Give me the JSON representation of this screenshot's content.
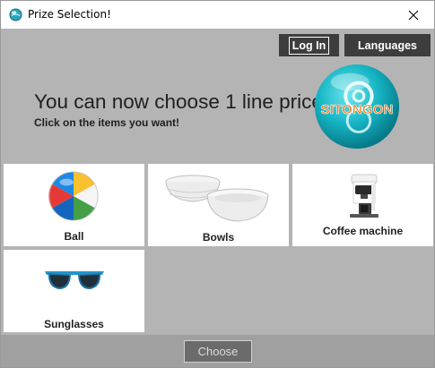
{
  "window": {
    "title": "Prize Selection!",
    "icon": "app-globe-icon"
  },
  "header": {
    "login_label": "Log In",
    "languages_label": "Languages",
    "headline": "You can now choose 1 line prices!",
    "subline": "Click on the items you want!",
    "logo_text": "SITONGON"
  },
  "items": [
    {
      "label": "Ball",
      "icon": "beach-ball-icon"
    },
    {
      "label": "Bowls",
      "icon": "bowls-icon"
    },
    {
      "label": "Coffee machine",
      "icon": "coffee-machine-icon"
    },
    {
      "label": "Sunglasses",
      "icon": "sunglasses-icon"
    }
  ],
  "footer": {
    "choose_label": "Choose"
  },
  "colors": {
    "background": "#b4b4b4",
    "dark_button": "#3d3d3d",
    "logo_teal": "#19b8c6",
    "logo_text": "#f07a1a"
  }
}
